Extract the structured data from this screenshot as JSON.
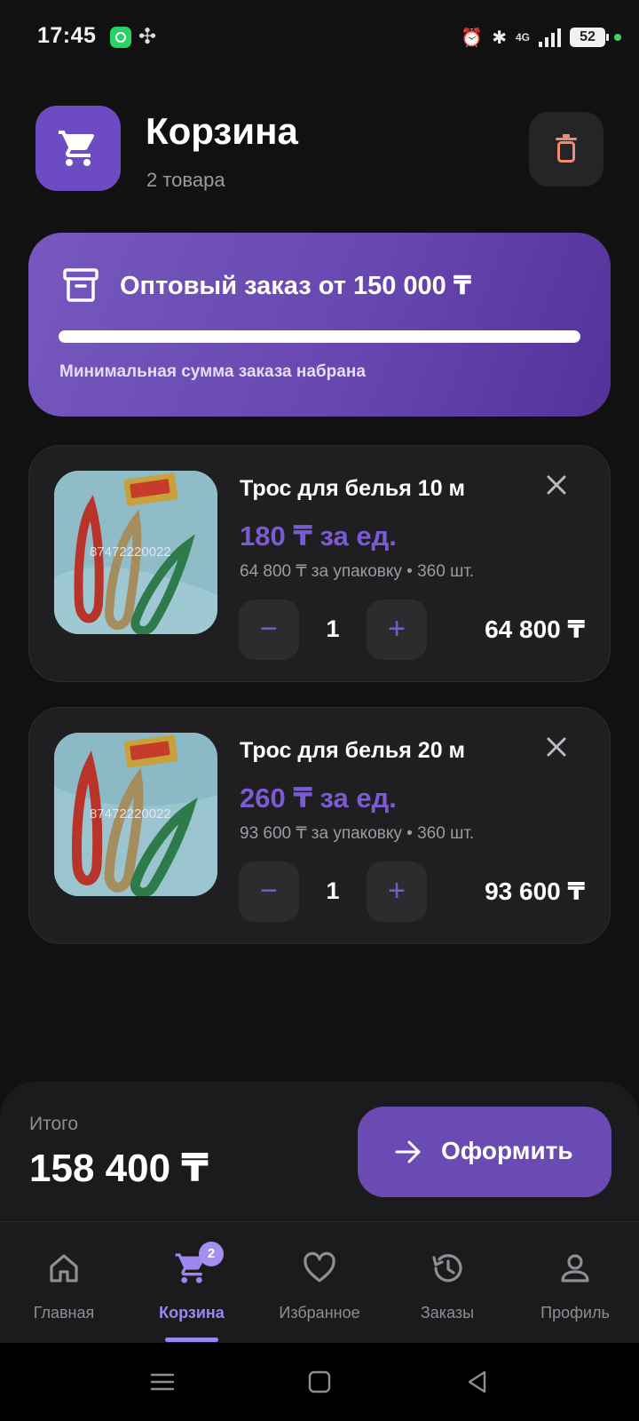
{
  "status_bar": {
    "time": "17:45",
    "network": "4G",
    "battery": "52",
    "icons": [
      "whatsapp-icon",
      "app-leaf-icon",
      "alarm-icon",
      "bluetooth-icon",
      "signal-icon",
      "battery-icon"
    ]
  },
  "header": {
    "title": "Корзина",
    "subtitle": "2 товара"
  },
  "wholesale_banner": {
    "title": "Оптовый заказ от 150 000 ₸",
    "progress_fraction": 1.0,
    "note": "Минимальная сумма заказа набрана"
  },
  "items": [
    {
      "name": "Трос для белья 10 м",
      "unit_price": "180 ₸ за ед.",
      "pack_info": "64 800 ₸ за упаковку • 360 шт.",
      "quantity": "1",
      "total": "64 800 ₸",
      "image_watermark": "87472220022"
    },
    {
      "name": "Трос для белья 20 м",
      "unit_price": "260 ₸ за ед.",
      "pack_info": "93 600 ₸ за упаковку • 360 шт.",
      "quantity": "1",
      "total": "93 600 ₸",
      "image_watermark": "87472220022"
    }
  ],
  "summary": {
    "total_label": "Итого",
    "total_value": "158 400 ₸",
    "checkout_label": "Оформить"
  },
  "tabs": [
    {
      "label": "Главная",
      "icon": "home-icon",
      "active": false
    },
    {
      "label": "Корзина",
      "icon": "cart-icon",
      "active": true,
      "badge": "2"
    },
    {
      "label": "Избранное",
      "icon": "heart-icon",
      "active": false
    },
    {
      "label": "Заказы",
      "icon": "history-icon",
      "active": false
    },
    {
      "label": "Профиль",
      "icon": "user-icon",
      "active": false
    }
  ],
  "colors": {
    "background": "#111112",
    "card": "#1f1f21",
    "accent": "#6a4bb4",
    "accent_light": "#9d86f0",
    "price": "#7b5bd1",
    "danger": "#f08a7a"
  }
}
